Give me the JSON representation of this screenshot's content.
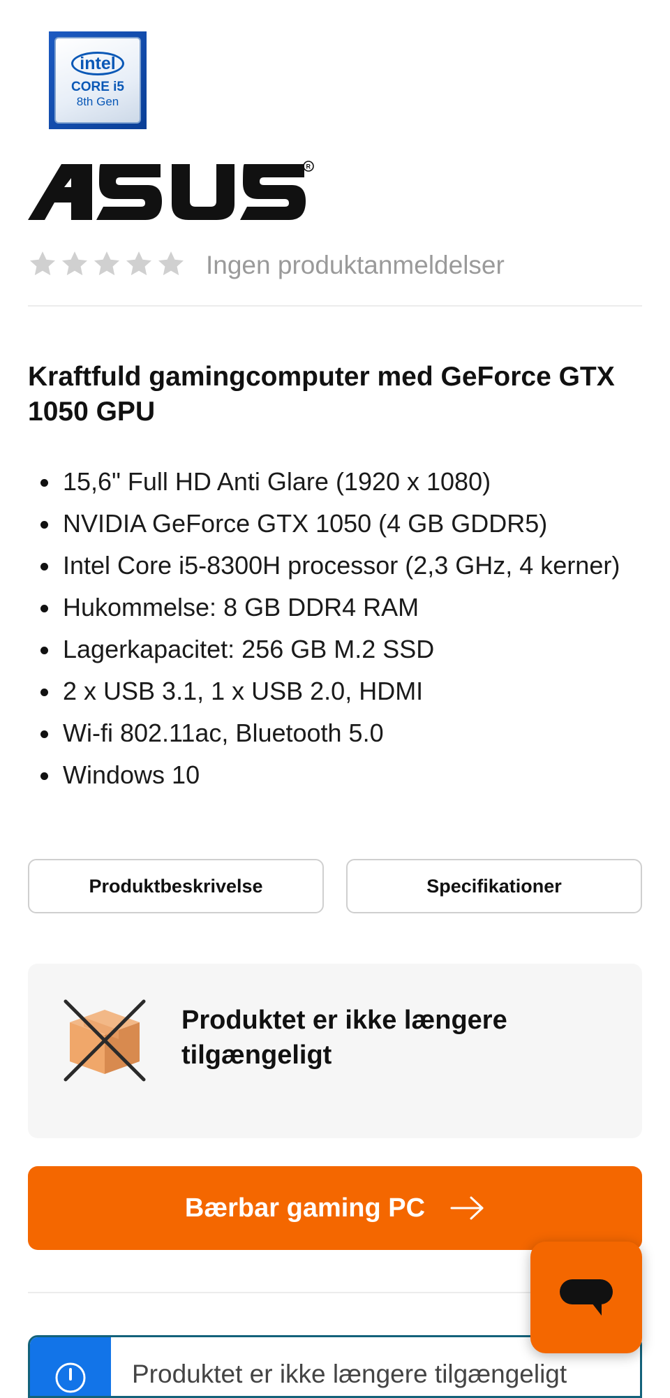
{
  "intel_badge": {
    "brand": "intel",
    "line1": "CORE i5",
    "line2": "8th Gen",
    "icon": "intel-core-i5-badge"
  },
  "brand": {
    "name": "ASUS",
    "registered": "®",
    "icon": "asus-logo"
  },
  "rating": {
    "stars_filled": 0,
    "stars_total": 5,
    "reviews_text": "Ingen produktanmeldelser"
  },
  "product": {
    "headline": "Kraftfuld gamingcomputer med GeForce GTX 1050 GPU",
    "features": [
      "15,6\" Full HD Anti Glare (1920 x 1080)",
      "NVIDIA GeForce GTX 1050 (4 GB GDDR5)",
      "Intel Core i5-8300H processor (2,3 GHz, 4 kerner)",
      "Hukommelse: 8 GB DDR4 RAM",
      "Lagerkapacitet: 256 GB M.2 SSD",
      "2 x USB 3.1, 1 x USB 2.0, HDMI",
      "Wi-fi 802.11ac, Bluetooth 5.0",
      "Windows 10"
    ]
  },
  "tabs": {
    "description": "Produktbeskrivelse",
    "specifications": "Specifikationer"
  },
  "availability": {
    "message": "Produktet er ikke længere tilgængeligt",
    "icon": "crossed-box-icon"
  },
  "cta": {
    "label": "Bærbar gaming PC",
    "icon": "arrow-right-icon"
  },
  "chat": {
    "icon": "chat-bubble-icon"
  },
  "notice": {
    "text": "Produktet er ikke længere tilgængeligt",
    "icon": "info-icon"
  },
  "colors": {
    "accent": "#f46700",
    "info": "#1274e8",
    "star_empty": "#d0d0d0",
    "muted_text": "#9a9a9a"
  }
}
